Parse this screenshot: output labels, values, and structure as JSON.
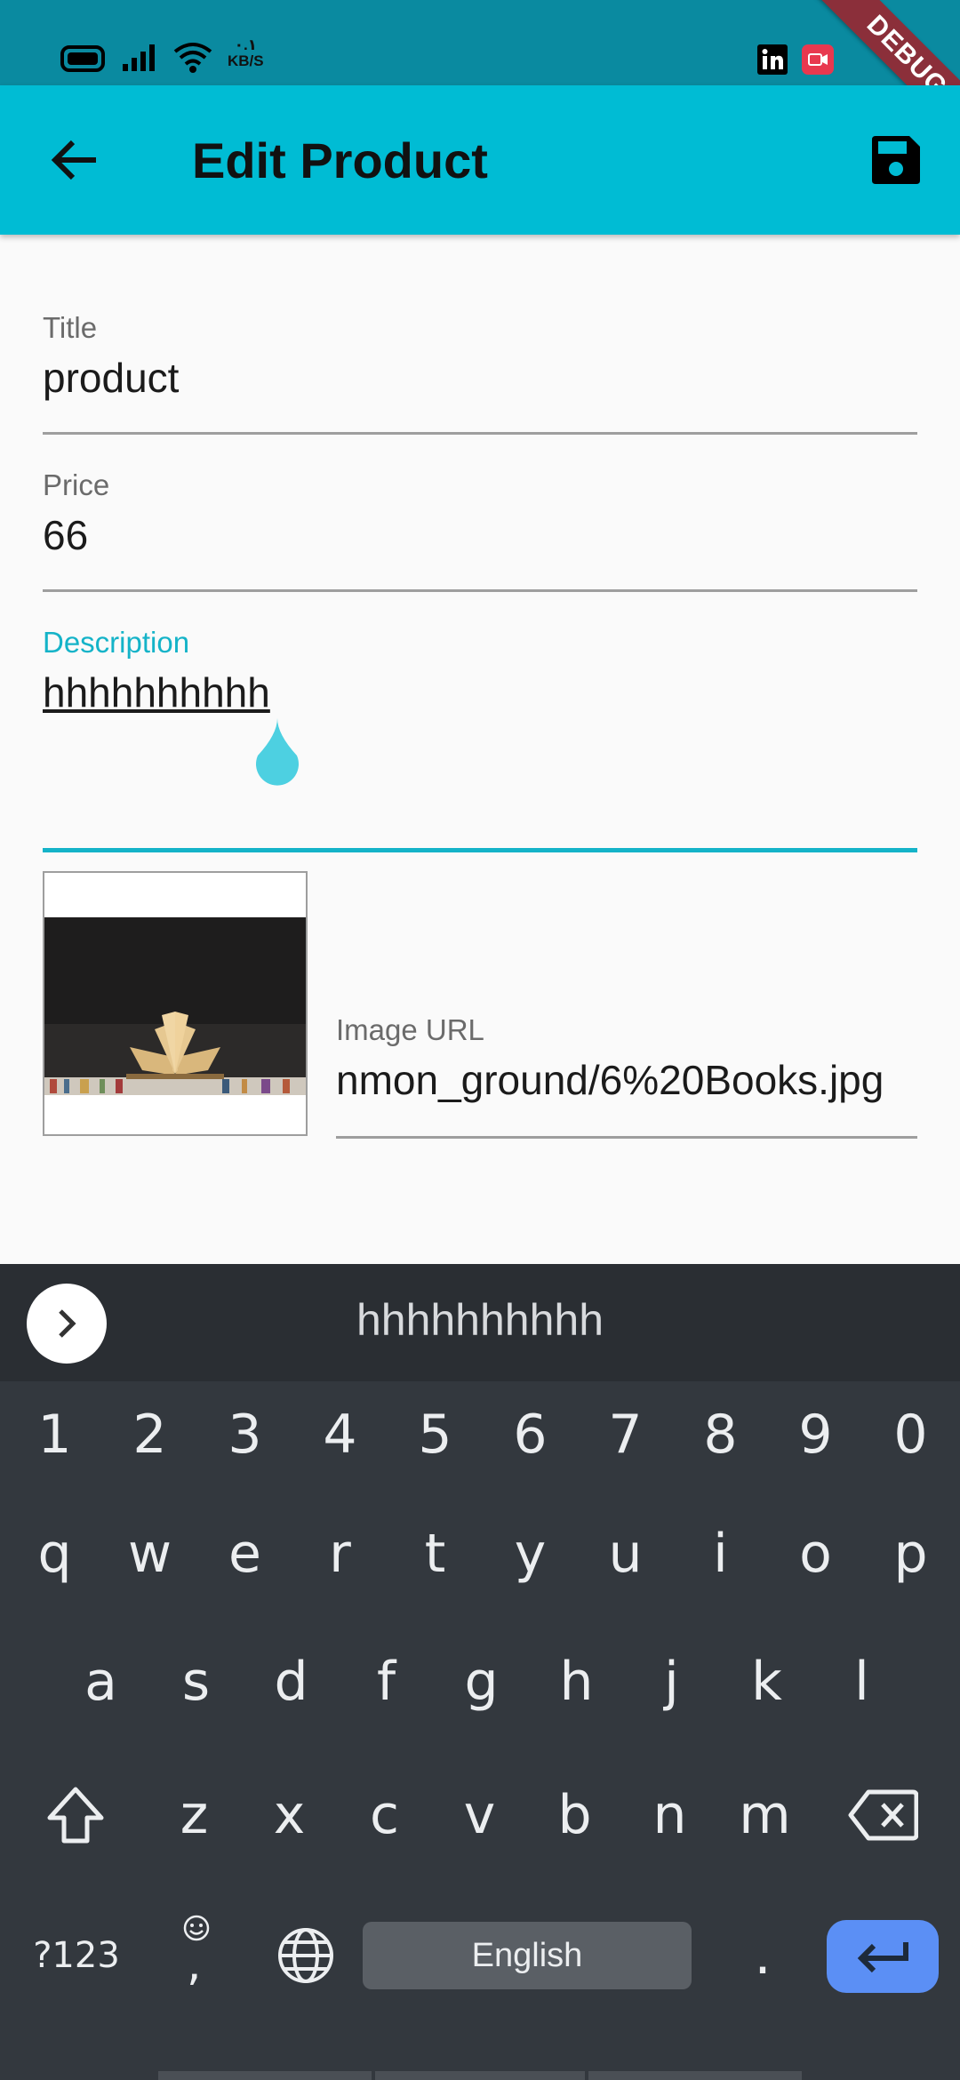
{
  "status_bar": {
    "net_speed_value": "٠.١",
    "net_speed_unit": "KB/S",
    "debug_label": "DEBUG"
  },
  "app_bar": {
    "title": "Edit Product"
  },
  "form": {
    "title_field": {
      "label": "Title",
      "value": "product"
    },
    "price_field": {
      "label": "Price",
      "value": "66"
    },
    "description_field": {
      "label": "Description",
      "value": "hhhhhhhhhh"
    },
    "image_url_field": {
      "label": "Image URL",
      "value": "nmon_ground/6%20Books.jpg"
    }
  },
  "keyboard": {
    "suggestion": "hhhhhhhhhh",
    "number_row": [
      "1",
      "2",
      "3",
      "4",
      "5",
      "6",
      "7",
      "8",
      "9",
      "0"
    ],
    "row1": [
      "q",
      "w",
      "e",
      "r",
      "t",
      "y",
      "u",
      "i",
      "o",
      "p"
    ],
    "row2": [
      "a",
      "s",
      "d",
      "f",
      "g",
      "h",
      "j",
      "k",
      "l"
    ],
    "row3": [
      "z",
      "x",
      "c",
      "v",
      "b",
      "n",
      "m"
    ],
    "symbols_key": "?123",
    "comma_key": ",",
    "space_label": "English",
    "period_key": "."
  },
  "colors": {
    "status_bar": "#0a8aa0",
    "app_bar": "#00bcd4",
    "accent": "#14b3c8",
    "keyboard_bg": "#33383e",
    "enter_key": "#5b8ff5"
  }
}
